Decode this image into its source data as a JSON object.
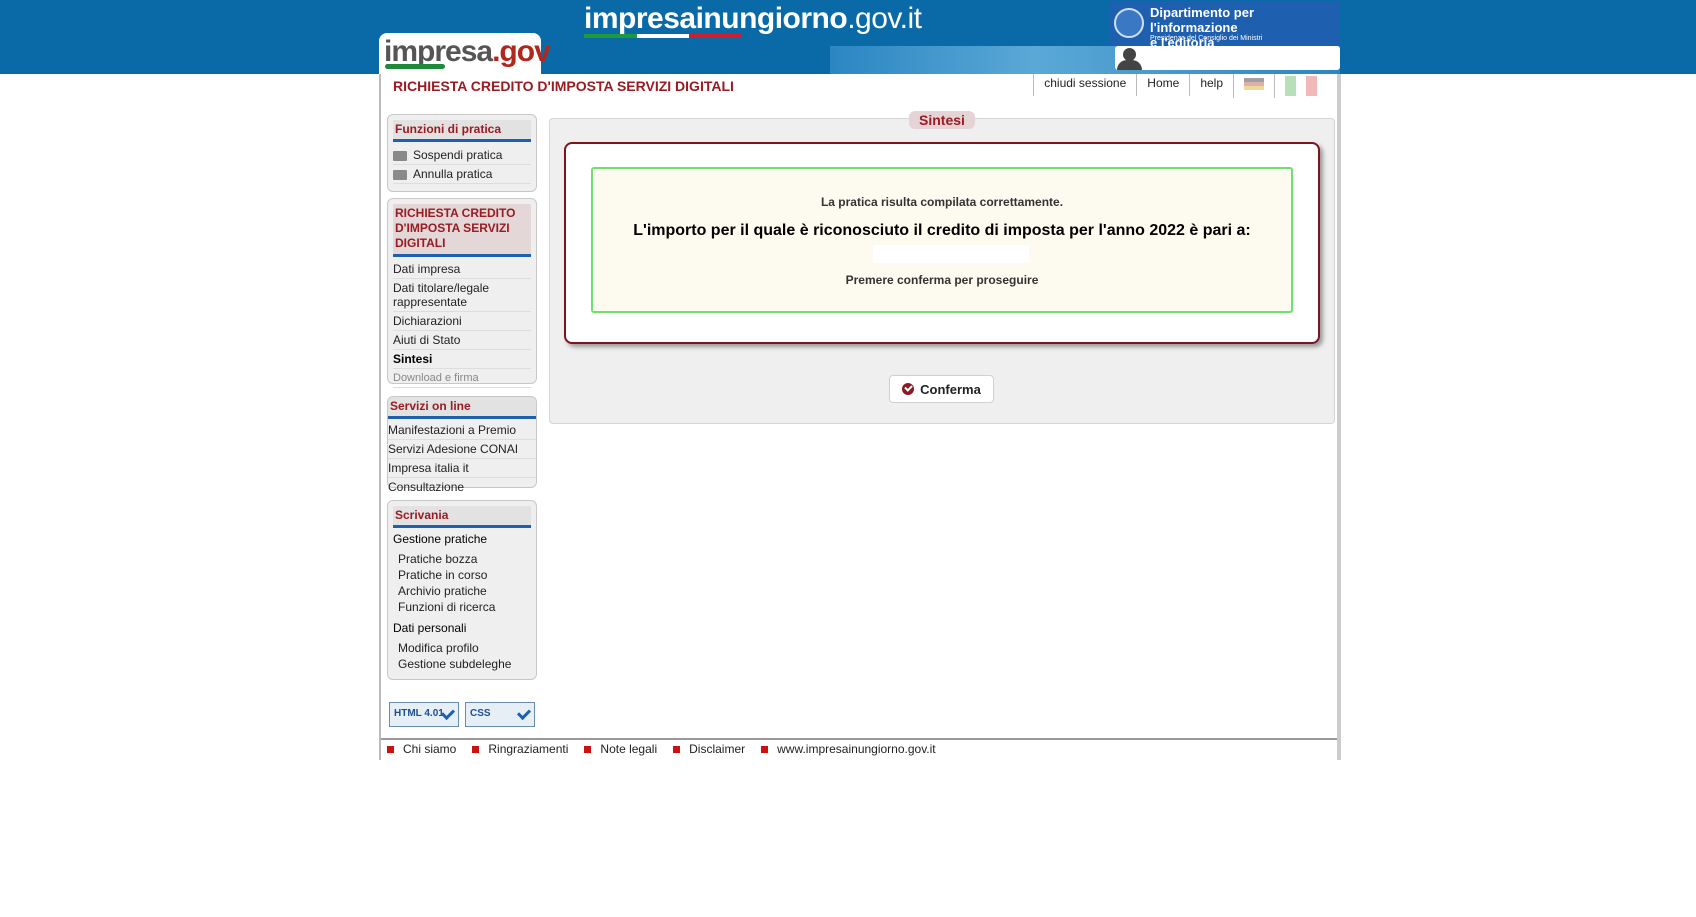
{
  "header": {
    "site_title_bold": "impresa",
    "site_title_mid": "inungiorno",
    "site_title_end": ".gov.it",
    "logo_part1": "impresa",
    "logo_part2": ".gov",
    "dept_line1": "Dipartimento per l'informazione",
    "dept_line2": "e l'editoria",
    "dept_line3": "Presidenza del Consiglio dei Ministri",
    "colors": {
      "bar": "#0a6aa8",
      "green": "#1f9a3a",
      "white": "#ffffff",
      "red": "#d01f2a"
    }
  },
  "page": {
    "title": "RICHIESTA CREDITO D'IMPOSTA SERVIZI DIGITALI",
    "toplinks": {
      "logout": "chiudi sessione",
      "home": "Home",
      "help": "help"
    }
  },
  "sidebar": {
    "funzioni": {
      "title": "Funzioni di pratica",
      "items": [
        {
          "label": "Sospendi pratica",
          "icon": "folder-icon"
        },
        {
          "label": "Annulla pratica",
          "icon": "folder-icon"
        }
      ]
    },
    "steps": {
      "title": "RICHIESTA CREDITO D'IMPOSTA SERVIZI DIGITALI",
      "items": [
        {
          "label": "Dati impresa"
        },
        {
          "label": "Dati titolare/legale rappresentate"
        },
        {
          "label": "Dichiarazioni"
        },
        {
          "label": "Aiuti di Stato"
        },
        {
          "label": "Sintesi"
        },
        {
          "label": "Download e firma"
        }
      ]
    },
    "servizi": {
      "title": "Servizi on line",
      "items": [
        {
          "label": "Manifestazioni a Premio"
        },
        {
          "label": "Servizi Adesione CONAI"
        },
        {
          "label": "Impresa italia it"
        },
        {
          "label": "Consultazione"
        }
      ]
    },
    "scrivania": {
      "title": "Scrivania",
      "group1": "Gestione pratiche",
      "group1_items": [
        {
          "label": "Pratiche bozza"
        },
        {
          "label": "Pratiche in corso"
        },
        {
          "label": "Archivio pratiche"
        },
        {
          "label": "Funzioni di ricerca"
        }
      ],
      "group2": "Dati personali",
      "group2_items": [
        {
          "label": "Modifica profilo"
        },
        {
          "label": "Gestione subdeleghe"
        }
      ]
    },
    "badges": {
      "html": "HTML 4.01",
      "css": "CSS"
    }
  },
  "main": {
    "title": "Sintesi",
    "msg1": "La pratica risulta compilata correttamente.",
    "msg2": "L'importo per il quale è riconosciuto il credito di imposta per l'anno 2022 è pari a:",
    "msg3": "Premere conferma per proseguire",
    "confirm_label": "Conferma"
  },
  "footer": {
    "items": [
      {
        "label": "Chi siamo"
      },
      {
        "label": "Ringraziamenti"
      },
      {
        "label": "Note legali"
      },
      {
        "label": "Disclaimer"
      },
      {
        "label": "www.impresainungiorno.gov.it"
      }
    ]
  }
}
